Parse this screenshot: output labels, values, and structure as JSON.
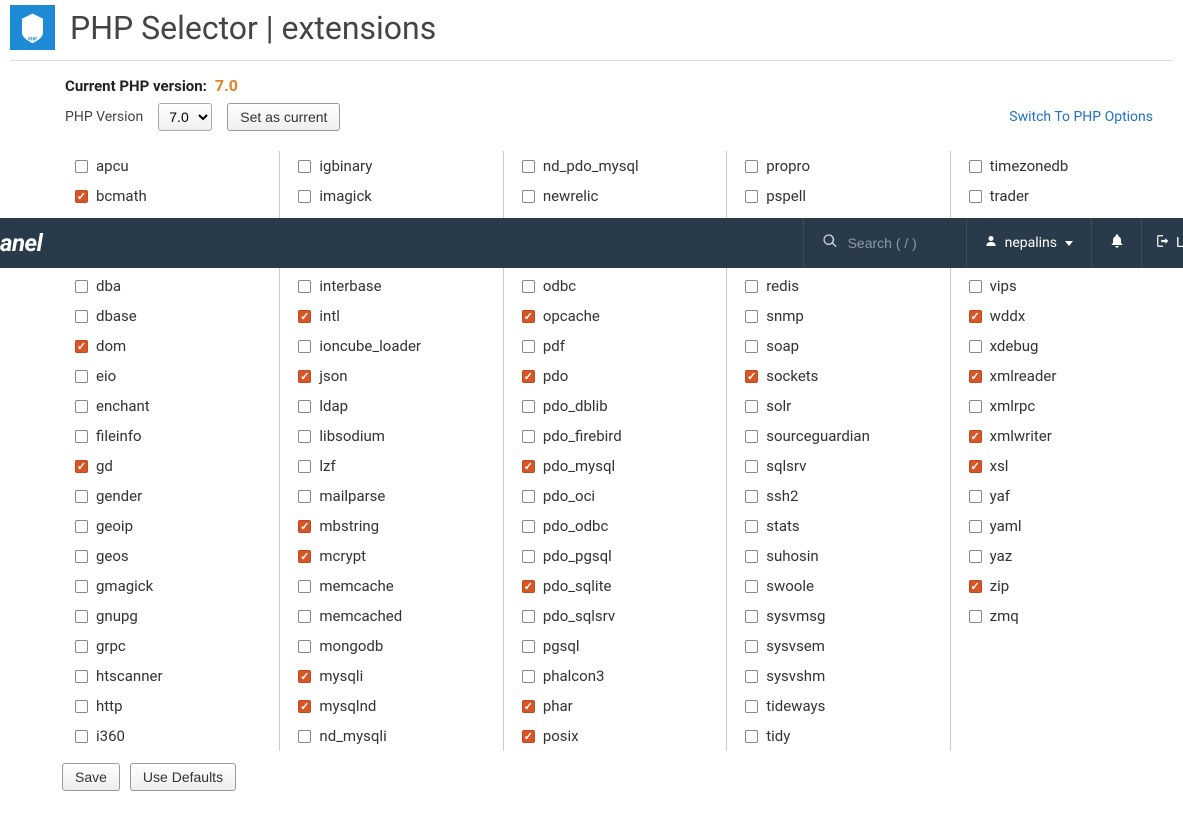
{
  "title": "PHP Selector | extensions",
  "current_label": "Current PHP version:",
  "current_version": "7.0",
  "php_version_label": "PHP Version",
  "version_options": [
    "7.0"
  ],
  "set_current_btn": "Set as current",
  "switch_link": "Switch To PHP Options",
  "save_btn": "Save",
  "defaults_btn": "Use Defaults",
  "bar": {
    "logo": "anel",
    "search_placeholder": "Search ( / )",
    "user": "nepalins",
    "logout_partial": "LO"
  },
  "columns": [
    [
      {
        "label": "apcu",
        "checked": false
      },
      {
        "label": "bcmath",
        "checked": true
      },
      {
        "label": "",
        "checked": false,
        "hidden": true
      },
      {
        "label": "",
        "checked": false,
        "hidden": true
      },
      {
        "label": "dba",
        "checked": false
      },
      {
        "label": "dbase",
        "checked": false
      },
      {
        "label": "dom",
        "checked": true
      },
      {
        "label": "eio",
        "checked": false
      },
      {
        "label": "enchant",
        "checked": false
      },
      {
        "label": "fileinfo",
        "checked": false
      },
      {
        "label": "gd",
        "checked": true
      },
      {
        "label": "gender",
        "checked": false
      },
      {
        "label": "geoip",
        "checked": false
      },
      {
        "label": "geos",
        "checked": false
      },
      {
        "label": "gmagick",
        "checked": false
      },
      {
        "label": "gnupg",
        "checked": false
      },
      {
        "label": "grpc",
        "checked": false
      },
      {
        "label": "htscanner",
        "checked": false
      },
      {
        "label": "http",
        "checked": false
      },
      {
        "label": "i360",
        "checked": false
      }
    ],
    [
      {
        "label": "igbinary",
        "checked": false
      },
      {
        "label": "imagick",
        "checked": false
      },
      {
        "label": "",
        "checked": false,
        "hidden": true
      },
      {
        "label": "",
        "checked": false,
        "hidden": true
      },
      {
        "label": "interbase",
        "checked": false
      },
      {
        "label": "intl",
        "checked": true
      },
      {
        "label": "ioncube_loader",
        "checked": false
      },
      {
        "label": "json",
        "checked": true
      },
      {
        "label": "ldap",
        "checked": false
      },
      {
        "label": "libsodium",
        "checked": false
      },
      {
        "label": "lzf",
        "checked": false
      },
      {
        "label": "mailparse",
        "checked": false
      },
      {
        "label": "mbstring",
        "checked": true
      },
      {
        "label": "mcrypt",
        "checked": true
      },
      {
        "label": "memcache",
        "checked": false
      },
      {
        "label": "memcached",
        "checked": false
      },
      {
        "label": "mongodb",
        "checked": false
      },
      {
        "label": "mysqli",
        "checked": true
      },
      {
        "label": "mysqlnd",
        "checked": true
      },
      {
        "label": "nd_mysqli",
        "checked": false
      }
    ],
    [
      {
        "label": "nd_pdo_mysql",
        "checked": false
      },
      {
        "label": "newrelic",
        "checked": false
      },
      {
        "label": "",
        "checked": false,
        "hidden": true
      },
      {
        "label": "",
        "checked": false,
        "hidden": true
      },
      {
        "label": "odbc",
        "checked": false
      },
      {
        "label": "opcache",
        "checked": true
      },
      {
        "label": "pdf",
        "checked": false
      },
      {
        "label": "pdo",
        "checked": true
      },
      {
        "label": "pdo_dblib",
        "checked": false
      },
      {
        "label": "pdo_firebird",
        "checked": false
      },
      {
        "label": "pdo_mysql",
        "checked": true
      },
      {
        "label": "pdo_oci",
        "checked": false
      },
      {
        "label": "pdo_odbc",
        "checked": false
      },
      {
        "label": "pdo_pgsql",
        "checked": false
      },
      {
        "label": "pdo_sqlite",
        "checked": true
      },
      {
        "label": "pdo_sqlsrv",
        "checked": false
      },
      {
        "label": "pgsql",
        "checked": false
      },
      {
        "label": "phalcon3",
        "checked": false
      },
      {
        "label": "phar",
        "checked": true
      },
      {
        "label": "posix",
        "checked": true
      }
    ],
    [
      {
        "label": "propro",
        "checked": false
      },
      {
        "label": "pspell",
        "checked": false
      },
      {
        "label": "",
        "checked": false,
        "hidden": true
      },
      {
        "label": "",
        "checked": false,
        "hidden": true
      },
      {
        "label": "redis",
        "checked": false
      },
      {
        "label": "snmp",
        "checked": false
      },
      {
        "label": "soap",
        "checked": false
      },
      {
        "label": "sockets",
        "checked": true
      },
      {
        "label": "solr",
        "checked": false
      },
      {
        "label": "sourceguardian",
        "checked": false
      },
      {
        "label": "sqlsrv",
        "checked": false
      },
      {
        "label": "ssh2",
        "checked": false
      },
      {
        "label": "stats",
        "checked": false
      },
      {
        "label": "suhosin",
        "checked": false
      },
      {
        "label": "swoole",
        "checked": false
      },
      {
        "label": "sysvmsg",
        "checked": false
      },
      {
        "label": "sysvsem",
        "checked": false
      },
      {
        "label": "sysvshm",
        "checked": false
      },
      {
        "label": "tideways",
        "checked": false
      },
      {
        "label": "tidy",
        "checked": false
      }
    ],
    [
      {
        "label": "timezonedb",
        "checked": false
      },
      {
        "label": "trader",
        "checked": false
      },
      {
        "label": "",
        "checked": false,
        "hidden": true
      },
      {
        "label": "",
        "checked": false,
        "hidden": true
      },
      {
        "label": "vips",
        "checked": false
      },
      {
        "label": "wddx",
        "checked": true
      },
      {
        "label": "xdebug",
        "checked": false
      },
      {
        "label": "xmlreader",
        "checked": true
      },
      {
        "label": "xmlrpc",
        "checked": false
      },
      {
        "label": "xmlwriter",
        "checked": true
      },
      {
        "label": "xsl",
        "checked": true
      },
      {
        "label": "yaf",
        "checked": false
      },
      {
        "label": "yaml",
        "checked": false
      },
      {
        "label": "yaz",
        "checked": false
      },
      {
        "label": "zip",
        "checked": true
      },
      {
        "label": "zmq",
        "checked": false
      }
    ]
  ]
}
